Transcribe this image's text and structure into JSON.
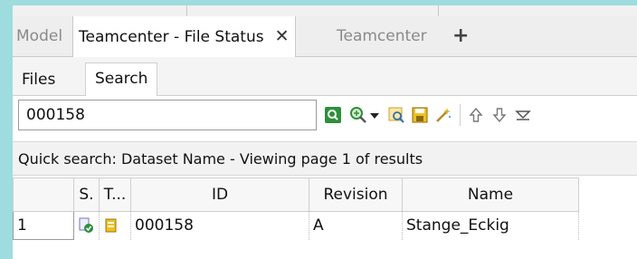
{
  "tabs": {
    "model": "Model",
    "file_status": "Teamcenter - File Status",
    "close_glyph": "✕",
    "teamcenter": "Teamcenter",
    "add_glyph": "+"
  },
  "subtabs": {
    "files": "Files",
    "search": "Search"
  },
  "search": {
    "value": "000158"
  },
  "toolbar_icons": [
    "search-go-icon",
    "zoom-search-icon",
    "dropdown-arrow-icon",
    "find-icon",
    "save-icon",
    "magic-wand-icon",
    "arrow-up-icon",
    "arrow-down-icon",
    "menu-collapse-icon"
  ],
  "status": {
    "text": "Quick search: Dataset Name - Viewing page 1 of results"
  },
  "grid": {
    "headers": [
      "",
      "S.",
      "T...",
      "ID",
      "Revision",
      "Name"
    ],
    "rows": [
      {
        "num": "1",
        "id": "000158",
        "revision": "A",
        "name": "Stange_Eckig"
      }
    ]
  },
  "colors": {
    "background": "#9fdcdd",
    "accent_green": "#2f8f3a",
    "icon_yellow": "#f0c020"
  }
}
